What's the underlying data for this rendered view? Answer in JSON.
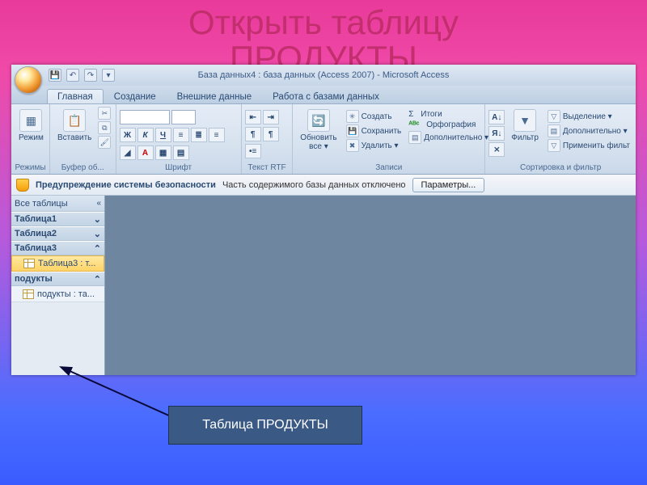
{
  "slide": {
    "title_line1": "Открыть таблицу",
    "title_line2": "ПРОДУКТЫ"
  },
  "titlebar": {
    "text": "База данных4 : база данных (Access 2007) - Microsoft Access",
    "qat": {
      "save": "💾",
      "undo": "↶",
      "redo": "↷",
      "more": "▾"
    }
  },
  "tabs": {
    "home": "Главная",
    "create": "Создание",
    "external": "Внешние данные",
    "dbtools": "Работа с базами данных"
  },
  "ribbon": {
    "views": {
      "label": "Режимы",
      "btn": "Режим"
    },
    "clipboard": {
      "label": "Буфер об...",
      "paste": "Вставить"
    },
    "font": {
      "label": "Шрифт",
      "bold": "Ж",
      "italic": "К",
      "underline": "Ч"
    },
    "richtext": {
      "label": "Текст RTF"
    },
    "records": {
      "label": "Записи",
      "refresh": "Обновить\nвсе ▾",
      "new": "Создать",
      "save": "Сохранить",
      "delete": "Удалить ▾",
      "totals": "Итоги",
      "spelling": "Орфография",
      "more": "Дополнительно ▾"
    },
    "sortfilter": {
      "label": "Сортировка и фильтр",
      "filter": "Фильтр",
      "selection": "Выделение ▾",
      "advanced": "Дополнительно ▾",
      "toggle": "Применить фильт"
    }
  },
  "security": {
    "title": "Предупреждение системы безопасности",
    "msg": "Часть содержимого базы данных отключено",
    "options": "Параметры..."
  },
  "nav": {
    "header": "Все таблицы",
    "g1": "Таблица1",
    "g2": "Таблица2",
    "g3": "Таблица3",
    "g3_item": "Таблица3 : т...",
    "g4": "подукты",
    "g4_item": "подукты : та..."
  },
  "callout": {
    "label": "Таблица ПРОДУКТЫ"
  },
  "glyph": {
    "sigma": "Σ",
    "abc": "ᴬᴮᶜ",
    "chev_dd": "«",
    "chev_v": "⌄",
    "chev_a": "⌃",
    "sort_az": "А↓",
    "sort_za": "Я↓"
  }
}
